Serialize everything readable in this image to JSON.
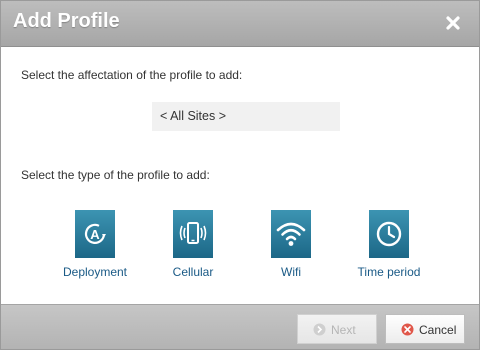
{
  "dialog": {
    "title": "Add Profile"
  },
  "affectation": {
    "prompt": "Select the affectation of the profile to add:",
    "selected": "< All Sites >"
  },
  "profile_types": {
    "prompt": "Select the type of the profile to add:",
    "items": [
      {
        "label": "Deployment",
        "icon": "deployment-icon"
      },
      {
        "label": "Cellular",
        "icon": "cellular-icon"
      },
      {
        "label": "Wifi",
        "icon": "wifi-icon"
      },
      {
        "label": "Time period",
        "icon": "clock-icon"
      }
    ]
  },
  "footer": {
    "next_label": "Next",
    "cancel_label": "Cancel",
    "next_enabled": false
  },
  "colors": {
    "accent": "#1c6787",
    "link": "#1a5a86",
    "cancel_icon": "#e0574a"
  }
}
